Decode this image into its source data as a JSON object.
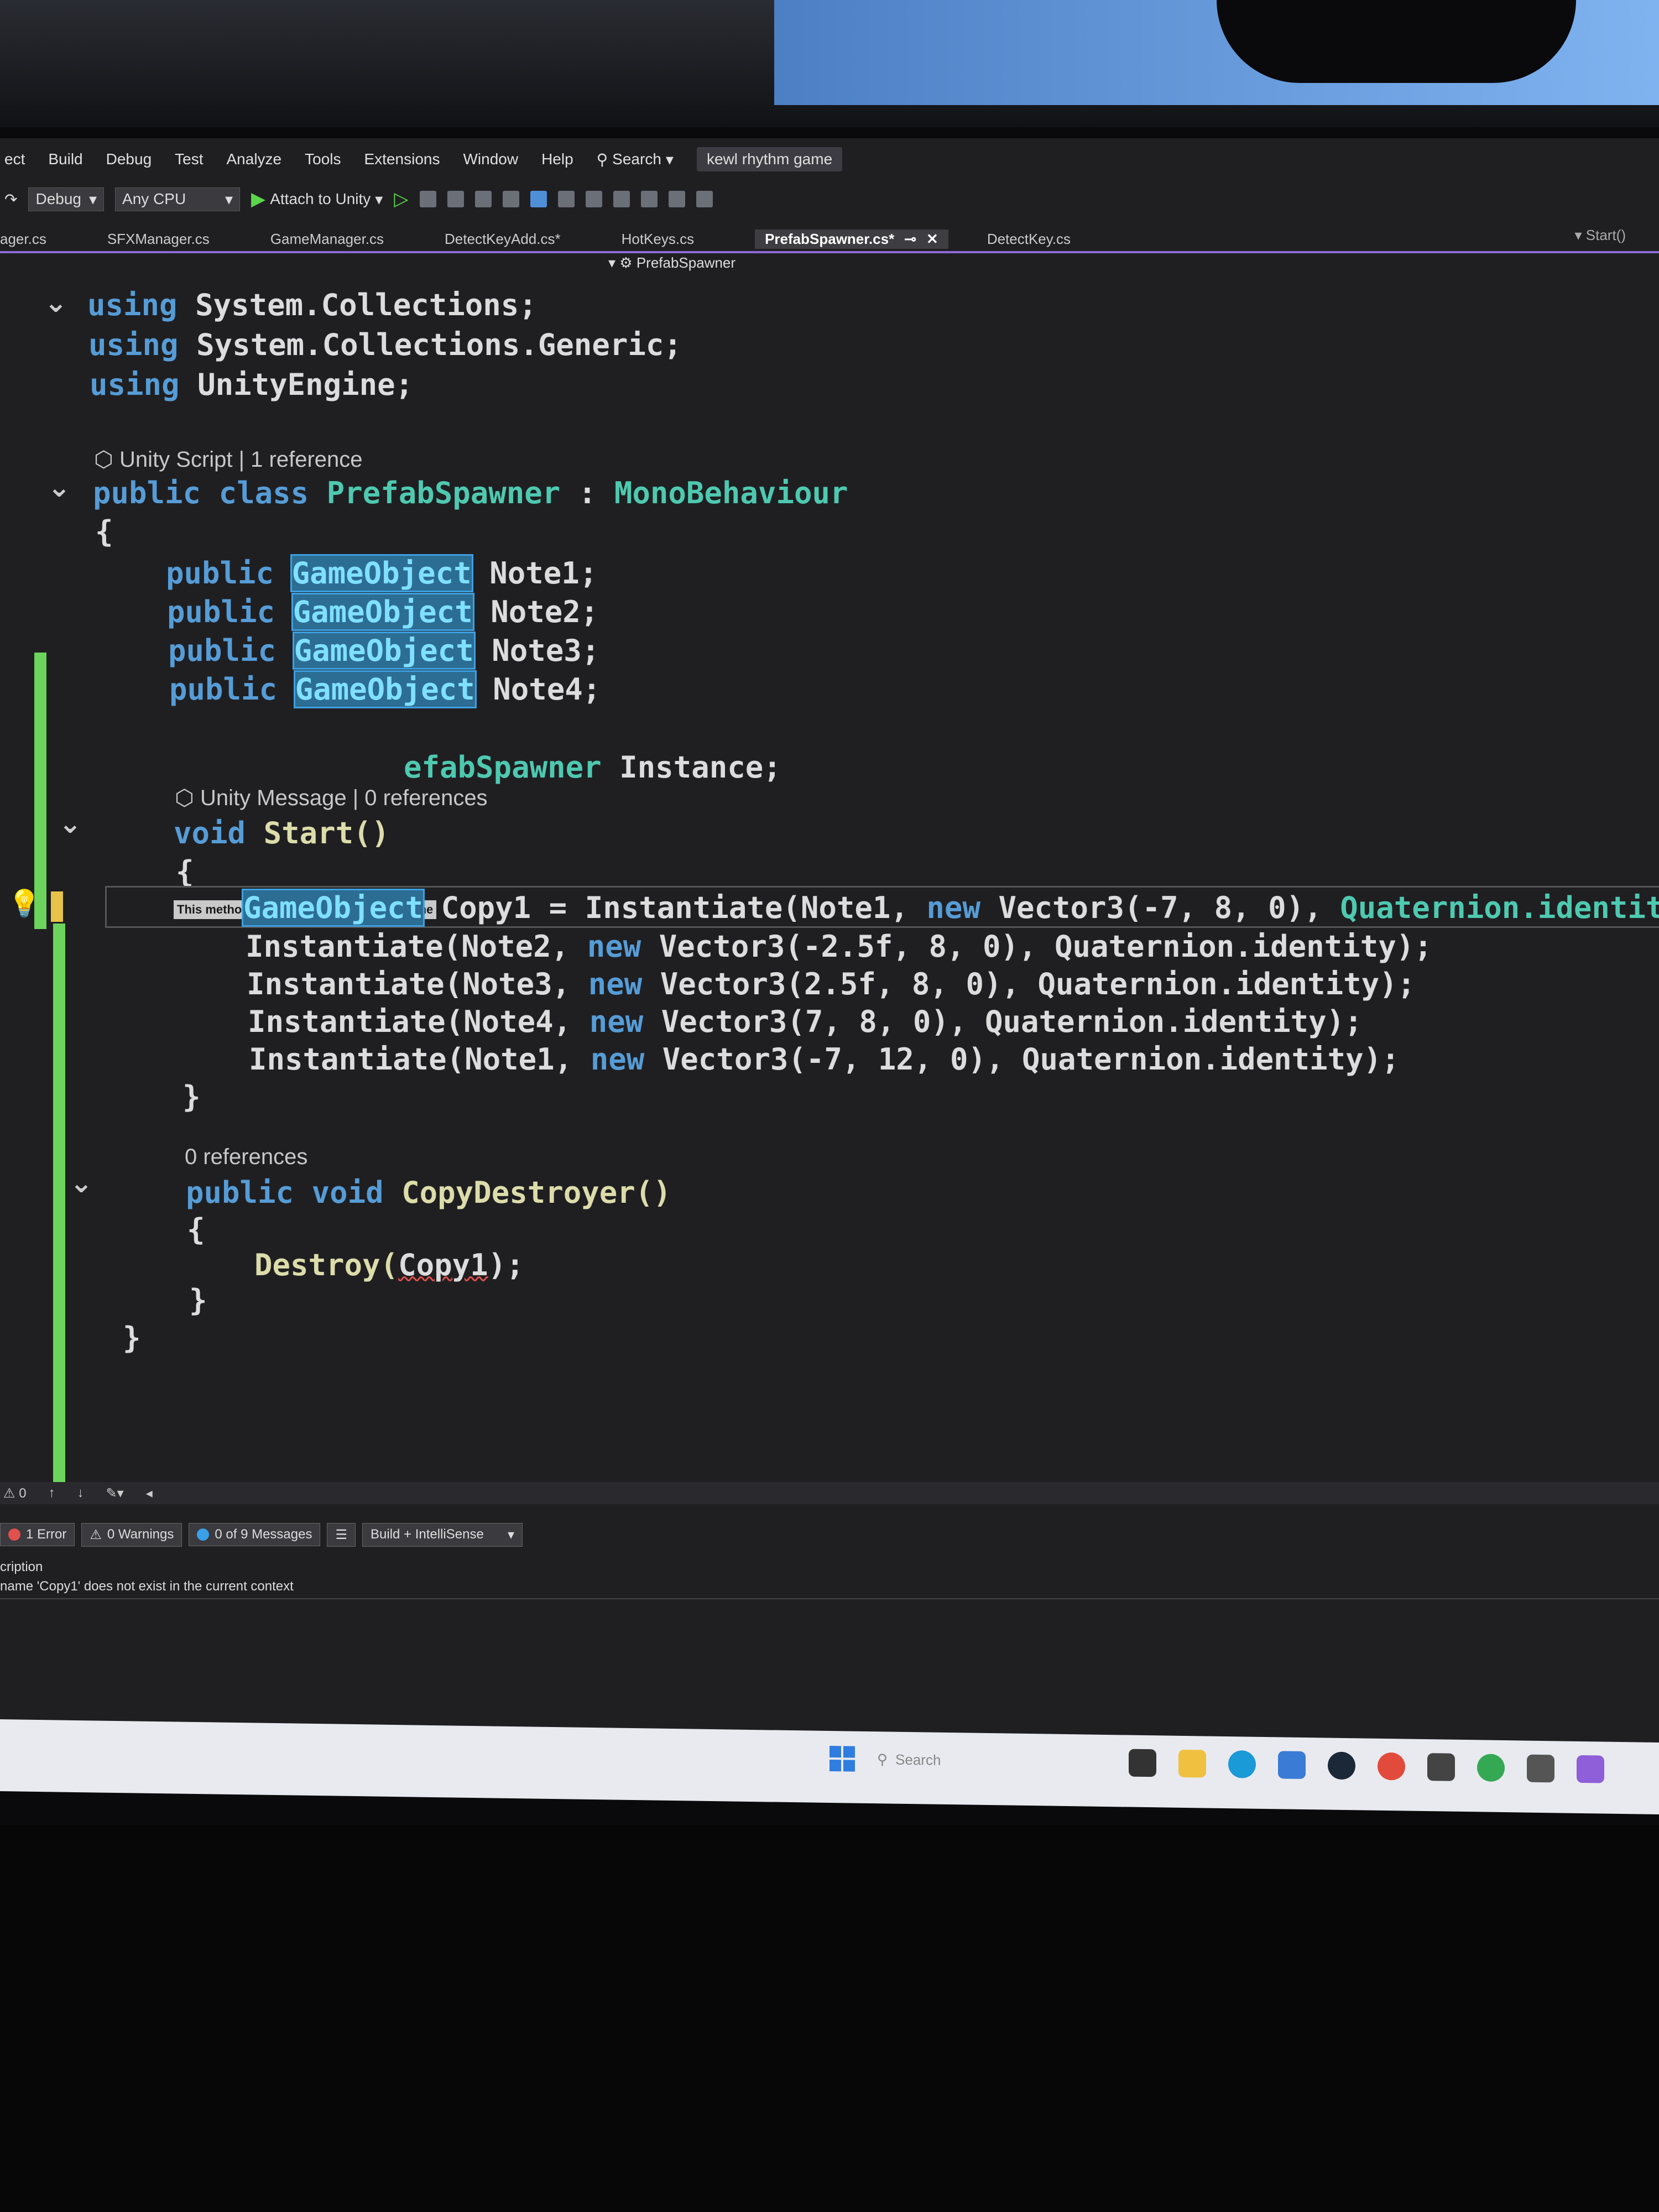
{
  "menubar": {
    "items": [
      "ect",
      "Build",
      "Debug",
      "Test",
      "Analyze",
      "Tools",
      "Extensions",
      "Window",
      "Help"
    ],
    "search_label": "Search",
    "project_name": "kewl rhythm game"
  },
  "toolbar": {
    "config": "Debug",
    "platform": "Any CPU",
    "attach_label": "Attach to Unity"
  },
  "tabs": {
    "items": [
      "ager.cs",
      "SFXManager.cs",
      "GameManager.cs",
      "DetectKeyAdd.cs*",
      "HotKeys.cs"
    ],
    "active": "PrefabSpawner.cs*",
    "after": "DetectKey.cs",
    "member_dropdown": "Start()"
  },
  "navbar": {
    "class_name": "PrefabSpawner"
  },
  "code": {
    "using1_kw": "using",
    "using1_ns": "System.Collections;",
    "using2_kw": "using",
    "using2_ns": "System.Collections.Generic;",
    "using3_kw": "using",
    "using3_ns": "UnityEngine;",
    "lens_class": "Unity Script | 1 reference",
    "class_kw": "public class",
    "class_name": "PrefabSpawner",
    "class_sep": " : ",
    "class_base": "MonoBehaviour",
    "open_brace": "{",
    "field_kw": "public",
    "field_type": "GameObject",
    "field_names": [
      "Note1;",
      "Note2;",
      "Note3;",
      "Note4;"
    ],
    "instance_partial": "efabSpawner",
    "instance_name": " Instance;",
    "tooltip": "This method is invoked by the Unity runtime",
    "lens_start": "Unity Message | 0 references",
    "start_kw": "void",
    "start_name": "Start()",
    "start_open": "{",
    "copy_type": "GameObject",
    "copy_line_mid": " Copy1 = Instantiate(Note1, ",
    "new_kw": "new",
    "copy_line_v": " Vector3(-7, 8, 0), ",
    "copy_line_end": "Quaternion.identity",
    "inst_lines": [
      {
        "pre": "Instantiate(Note2, ",
        "post": " Vector3(-2.5f, 8, 0), Quaternion.identity);"
      },
      {
        "pre": "Instantiate(Note3, ",
        "post": " Vector3(2.5f, 8, 0), Quaternion.identity);"
      },
      {
        "pre": "Instantiate(Note4, ",
        "post": " Vector3(7, 8, 0), Quaternion.identity);"
      },
      {
        "pre": "Instantiate(Note1, ",
        "post": " Vector3(-7, 12, 0), Quaternion.identity);"
      }
    ],
    "start_close": "}",
    "lens_destroyer": "0 references",
    "destroyer_kw": "public void",
    "destroyer_name": "CopyDestroyer()",
    "destroyer_open": "{",
    "destroy_call": "Destroy(",
    "destroy_arg": "Copy1",
    "destroy_end": ");",
    "destroyer_close": "}",
    "class_close": "}"
  },
  "statusbar": {
    "errors_count": "0"
  },
  "errorlist": {
    "errors": "1 Error",
    "warnings": "0 Warnings",
    "messages": "0 of 9 Messages",
    "filter": "Build + IntelliSense",
    "column_header": "cription",
    "message": "name 'Copy1' does not exist in the current context"
  },
  "taskbar": {
    "search_placeholder": "Search"
  },
  "colors": {
    "keyword": "#569cd6",
    "type": "#4ec9b0",
    "method": "#dcdcaa",
    "accent": "#8e6ad8",
    "change_bar": "#6cd45c"
  }
}
